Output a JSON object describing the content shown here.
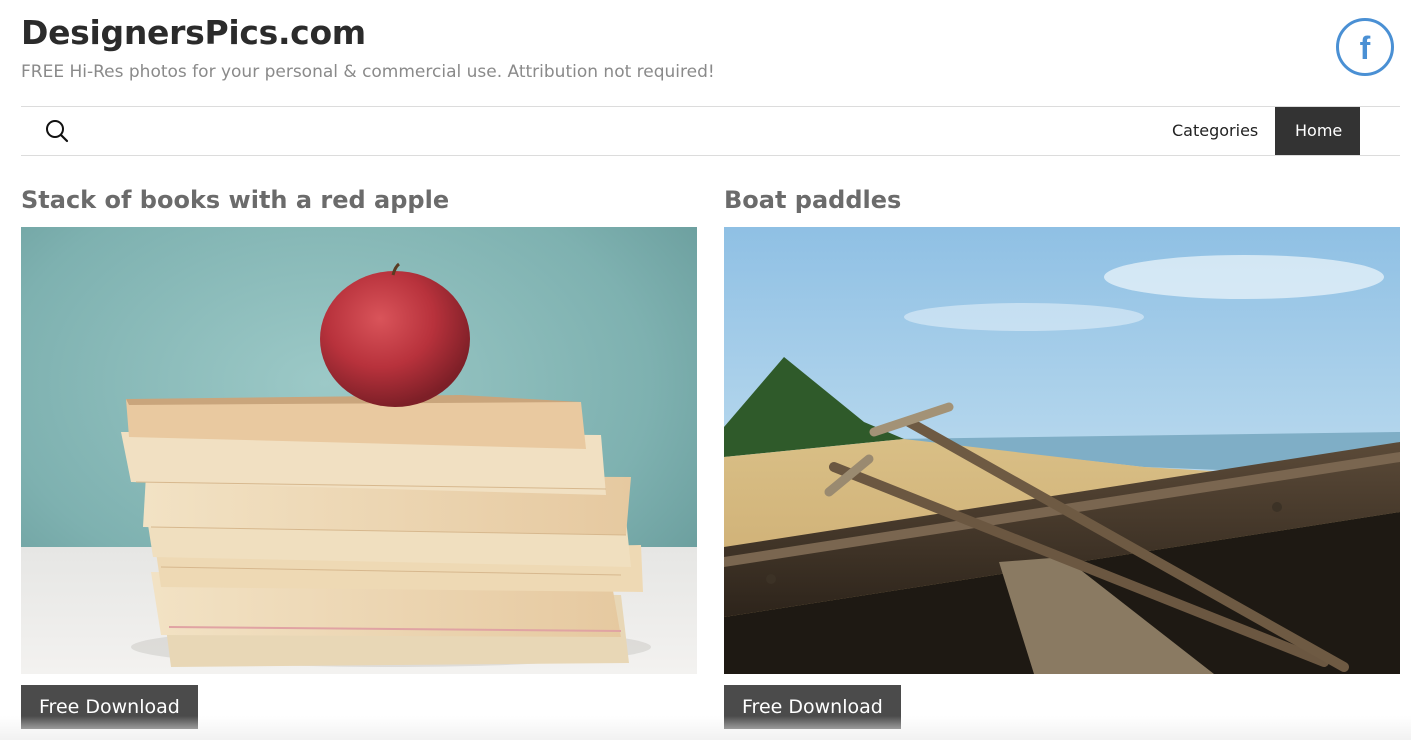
{
  "header": {
    "site_title": "DesignersPics.com",
    "tagline": "FREE Hi-Res photos for your personal & commercial use. Attribution not required!",
    "social": {
      "icon": "facebook-icon",
      "glyph": "f",
      "color": "#4a90d4"
    }
  },
  "nav": {
    "search_icon": "search-icon",
    "items": [
      {
        "label": "Categories",
        "active": false
      },
      {
        "label": "Home",
        "active": true
      }
    ]
  },
  "posts": [
    {
      "title": "Stack of books with a red apple",
      "image": "photo of stacked books topped by a red apple",
      "download_label": "Free Download"
    },
    {
      "title": "Boat paddles",
      "image": "photo of wooden oars resting on a boat at a beach",
      "download_label": "Free Download"
    }
  ],
  "colors": {
    "active_nav_bg": "#333333",
    "button_bg": "#4b4b4b",
    "title_gray": "#6b6b6b"
  }
}
